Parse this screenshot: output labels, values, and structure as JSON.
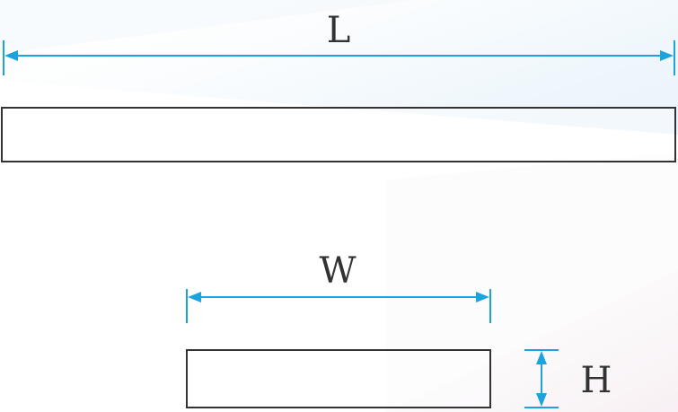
{
  "colors": {
    "dimension": "#1aa3dc",
    "outline": "#333333",
    "label": "#333333",
    "background_tint_blue": "#eaf4fb",
    "background_tint_pink": "#f7eef2"
  },
  "labels": {
    "length": "L",
    "width": "W",
    "height": "H"
  }
}
